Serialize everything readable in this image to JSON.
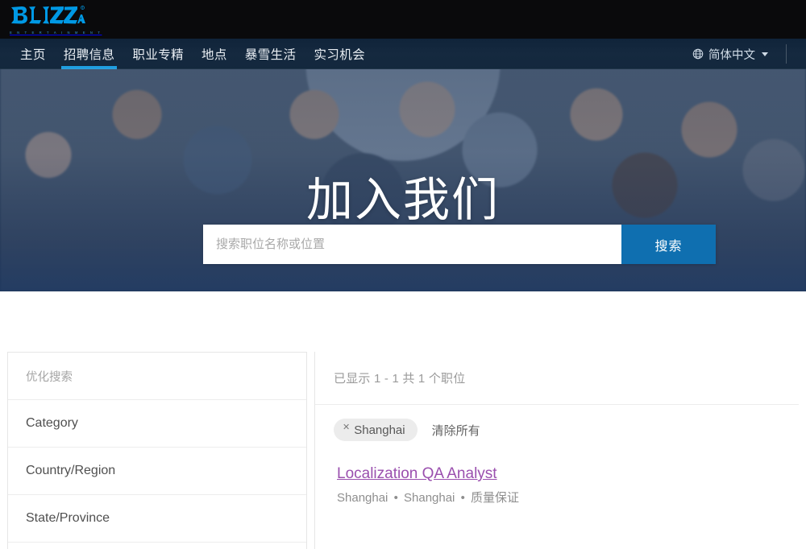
{
  "brand": {
    "logo_text": "BLIZZARD",
    "logo_sub": "E N T E R T A I N M E N T"
  },
  "nav": {
    "items": [
      {
        "label": "主页",
        "active": false
      },
      {
        "label": "招聘信息",
        "active": true
      },
      {
        "label": "职业专精",
        "active": false
      },
      {
        "label": "地点",
        "active": false
      },
      {
        "label": "暴雪生活",
        "active": false
      },
      {
        "label": "实习机会",
        "active": false
      }
    ],
    "language": {
      "icon": "globe-icon",
      "label": "简体中文",
      "caret": "chevron-down-icon"
    }
  },
  "hero": {
    "title": "加入我们",
    "search": {
      "placeholder": "搜索职位名称或位置",
      "value": "",
      "button_label": "搜索"
    }
  },
  "facets": {
    "header": "优化搜索",
    "rows": [
      {
        "label": "Category"
      },
      {
        "label": "Country/Region"
      },
      {
        "label": "State/Province"
      }
    ]
  },
  "results": {
    "count_text": "已显示 1 - 1 共 1 个职位",
    "chips": [
      {
        "remove_icon": "close-icon",
        "label": "Shanghai"
      }
    ],
    "clear_all_label": "清除所有",
    "jobs": [
      {
        "title": "Localization QA Analyst",
        "city": "Shanghai",
        "region": "Shanghai",
        "category": "质量保证"
      }
    ]
  },
  "colors": {
    "brand_blue": "#0099e5",
    "nav_active": "#1f9ee0",
    "search_button": "#0f6fb0",
    "job_link": "#9a4fae",
    "chip_bg": "#ececec"
  }
}
